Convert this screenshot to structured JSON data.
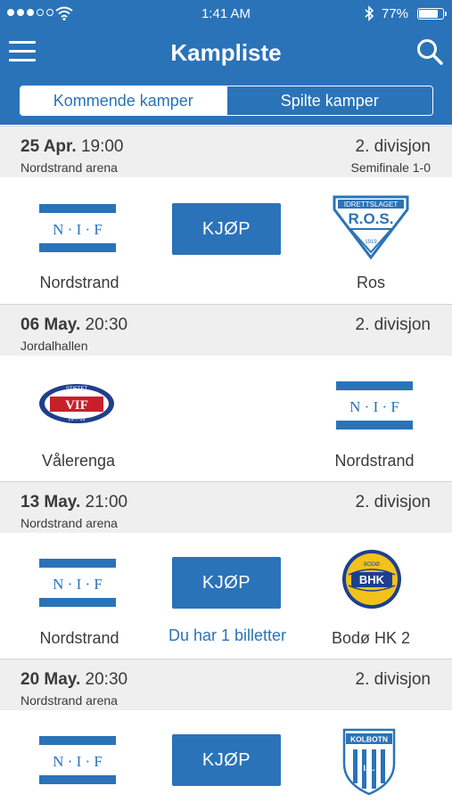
{
  "status": {
    "time": "1:41 AM",
    "battery": "77%"
  },
  "header": {
    "title": "Kampliste"
  },
  "tabs": {
    "upcoming": "Kommende kamper",
    "played": "Spilte kamper"
  },
  "matches": [
    {
      "date": "25 Apr.",
      "time": "19:00",
      "venue": "Nordstrand arena",
      "division": "2. divisjon",
      "result": "Semifinale 1-0",
      "home": "Nordstrand",
      "away": "Ros",
      "buy": "KJØP"
    },
    {
      "date": "06 May.",
      "time": "20:30",
      "venue": "Jordalhallen",
      "division": "2. divisjon",
      "home": "Vålerenga",
      "away": "Nordstrand"
    },
    {
      "date": "13 May.",
      "time": "21:00",
      "venue": "Nordstrand arena",
      "division": "2. divisjon",
      "home": "Nordstrand",
      "away": "Bodø HK 2",
      "buy": "KJØP",
      "tickets": "Du har 1 billetter"
    },
    {
      "date": "20 May.",
      "time": "20:30",
      "venue": "Nordstrand arena",
      "division": "2. divisjon",
      "buy": "KJØP"
    }
  ],
  "logos": {
    "nif": "N · I · F",
    "ros_top": "IDRETTSLAGET",
    "ros_main": "R.O.S.",
    "ros_year": "1919",
    "vif_top": "STIFTET",
    "vif_main": "VIF",
    "vif_date": "29·7·13",
    "bhk_top": "BODØ",
    "bhk_main": "BHK",
    "kolbotn_top": "KOLBOTN",
    "kolbotn_bottom": "I.L."
  },
  "colors": {
    "brand": "#2a73b8",
    "header_bg": "#efefef",
    "vif_blue": "#1f3f8c",
    "vif_red": "#c8202b",
    "bhk_yellow": "#f2c21a",
    "bhk_blue": "#1c3f8f"
  }
}
